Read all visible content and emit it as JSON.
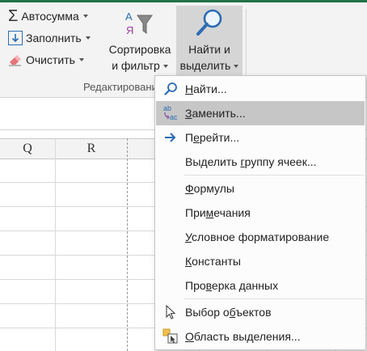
{
  "ribbon": {
    "autosum": "Автосумма",
    "fill": "Заполнить",
    "clear": "Очистить",
    "sort_filter": [
      "Сортировка",
      "и фильтр"
    ],
    "find_select": [
      "Найти и",
      "выделить"
    ],
    "group_label": "Редактирование"
  },
  "columns": [
    "Q",
    "R"
  ],
  "menu": {
    "items": [
      {
        "label": "Найти...",
        "icon": "search-icon"
      },
      {
        "label": "Заменить...",
        "icon": "replace-icon",
        "highlighted": true
      },
      {
        "label": "Перейти...",
        "icon": "arrow-right-icon"
      },
      {
        "label": "Выделить группу ячеек...",
        "icon": ""
      },
      {
        "label": "Формулы",
        "icon": ""
      },
      {
        "label": "Примечания",
        "icon": ""
      },
      {
        "label": "Условное форматирование",
        "icon": ""
      },
      {
        "label": "Константы",
        "icon": ""
      },
      {
        "label": "Проверка данных",
        "icon": ""
      },
      {
        "label": "Выбор объектов",
        "icon": "cursor-icon"
      },
      {
        "label": "Область выделения...",
        "icon": "selection-pane-icon"
      }
    ]
  },
  "colors": {
    "accent": "#217346",
    "highlight": "#c6c6c6",
    "blue_icon": "#2b6cb3"
  }
}
